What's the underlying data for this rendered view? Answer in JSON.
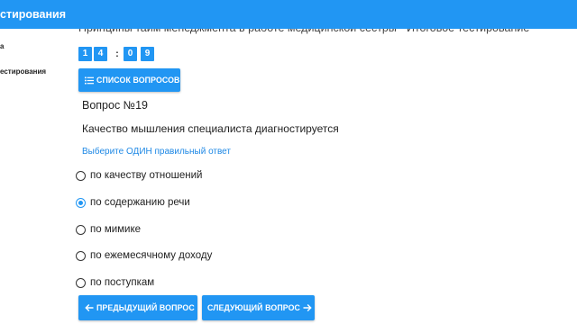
{
  "topbar": {
    "title": "стирования"
  },
  "sidebar": {
    "items": [
      {
        "label": "а"
      },
      {
        "label": "естирования"
      }
    ]
  },
  "test": {
    "title": "Принципы тайм менеджмента в работе медицинской сестры - Итоговое тестирование"
  },
  "timer": {
    "digits": [
      "1",
      "4",
      "0",
      "9"
    ],
    "separator": ":"
  },
  "question_list_button": {
    "label": "СПИСОК ВОПРОСОВ",
    "icon": "list-icon"
  },
  "question": {
    "number_label": "Вопрос №19",
    "text": "Качество мышления специалиста диагностируется",
    "instruction": "Выберите ОДИН правильный ответ"
  },
  "options": [
    {
      "label": "по качеству отношений",
      "selected": false
    },
    {
      "label": "по содержанию речи",
      "selected": true
    },
    {
      "label": "по мимике",
      "selected": false
    },
    {
      "label": "по ежемесячному доходу",
      "selected": false
    },
    {
      "label": "по поступкам",
      "selected": false
    }
  ],
  "navigation": {
    "prev_label": "ПРЕДЫДУЩИЙ ВОПРОС",
    "prev_icon": "arrow-left-icon",
    "next_label": "СЛЕДУЮЩИЙ ВОПРОС",
    "next_icon": "arrow-right-icon"
  },
  "colors": {
    "accent": "#2196f3",
    "instruction": "#1e88e5",
    "text": "#222222"
  }
}
